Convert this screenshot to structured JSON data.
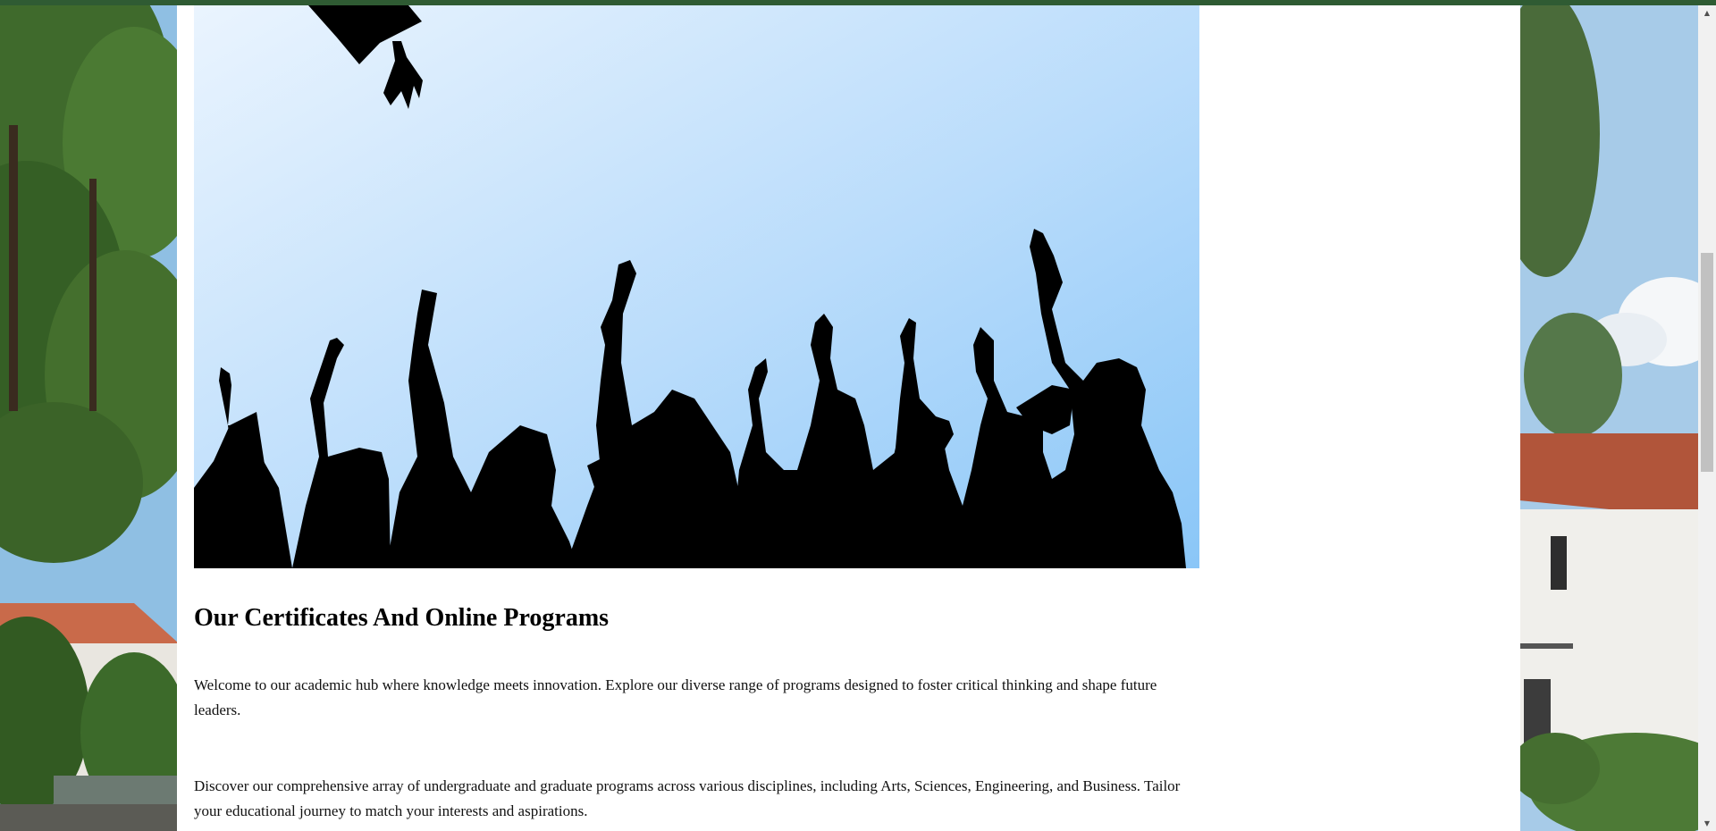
{
  "hero": {
    "image_alt": "Graduates celebrating, silhouettes throwing caps"
  },
  "section": {
    "title": "Our Certificates And Online Programs",
    "paragraphs": [
      "Welcome to our academic hub where knowledge meets innovation. Explore our diverse range of programs designed to foster critical thinking and shape future leaders.",
      "Discover our comprehensive array of undergraduate and graduate programs across various disciplines, including Arts, Sciences, Engineering, and Business. Tailor your educational journey to match your interests and aspirations."
    ]
  },
  "colors": {
    "top_bar": "#2f5b33",
    "sky_light": "#e8f3fe",
    "sky_dark": "#8cc8f8"
  },
  "scrollbar": {
    "up_arrow_icon": "triangle-up-icon",
    "down_arrow_icon": "triangle-down-icon"
  }
}
